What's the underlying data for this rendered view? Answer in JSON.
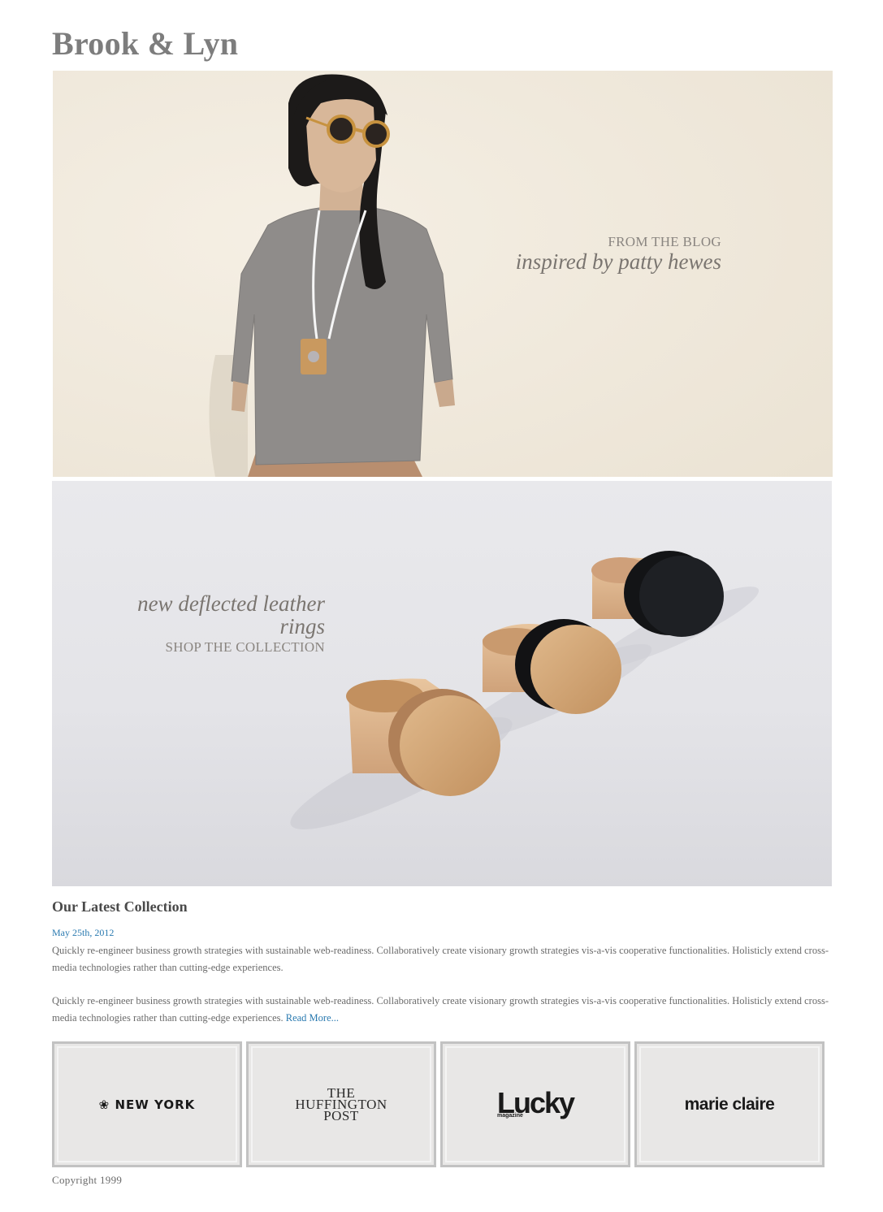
{
  "site": {
    "title": "Brook & Lyn"
  },
  "banners": {
    "blog": {
      "kicker": "FROM THE BLOG",
      "headline": "inspired by patty hewes"
    },
    "rings": {
      "headline": "new deflected leather rings",
      "cta": "SHOP THE COLLECTION"
    }
  },
  "article": {
    "title": "Our Latest Collection",
    "date": "May 25th, 2012",
    "paragraph_1": "Quickly re-engineer business growth strategies with sustainable web-readiness. Collaboratively create visionary growth strategies vis-a-vis cooperative functionalities. Holisticly extend cross-media technologies rather than cutting-edge experiences.",
    "paragraph_2": "Quickly re-engineer business growth strategies with sustainable web-readiness. Collaboratively create visionary growth strategies vis-a-vis cooperative functionalities. Holisticly extend cross-media technologies rather than cutting-edge experiences.",
    "read_more": "Read More..."
  },
  "press": [
    {
      "name": "NEW YORK",
      "icon": "nbc-peacock-icon"
    },
    {
      "name": "THE HUFFINGTON POST"
    },
    {
      "name": "Lucky",
      "sub": "magazine"
    },
    {
      "name": "marie claire"
    }
  ],
  "footer": {
    "copyright": "Copyright 1999"
  },
  "colors": {
    "title": "#7d7d7d",
    "link": "#2a7ab0",
    "press_border": "#c2c2c2",
    "press_bg": "#e8e7e6"
  }
}
